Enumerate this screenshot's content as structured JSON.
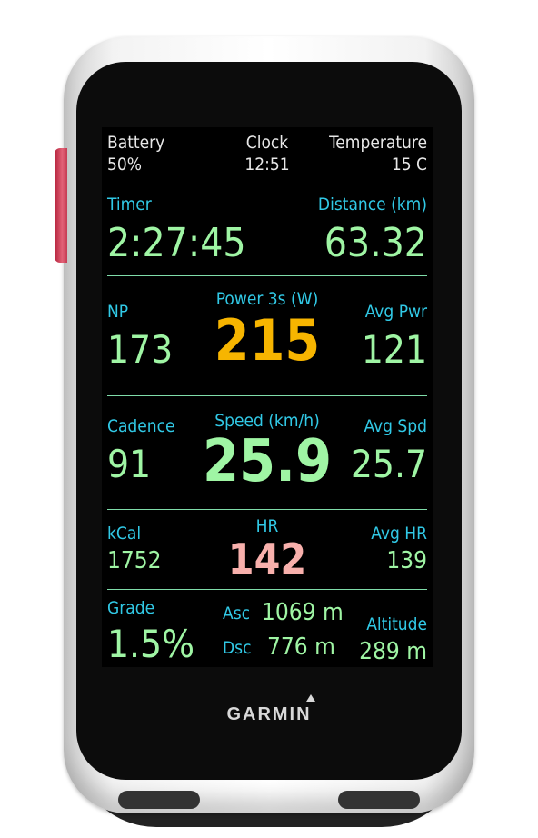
{
  "brand": "GARMIN",
  "colors": {
    "label": "#31c9e6",
    "value": "#9ff5a4",
    "power": "#f7b500",
    "hr": "#f8b0ac",
    "divider": "#7fdca9"
  },
  "top": {
    "battery_label": "Battery",
    "battery_value": "50%",
    "clock_label": "Clock",
    "clock_value": "12:51",
    "temp_label": "Temperature",
    "temp_value": "15 C"
  },
  "timer": {
    "label": "Timer",
    "value": "2:27:45"
  },
  "distance": {
    "label": "Distance (km)",
    "value": "63.32"
  },
  "np": {
    "label": "NP",
    "value": "173"
  },
  "power3s": {
    "label": "Power 3s (W)",
    "value": "215"
  },
  "avg_pwr": {
    "label": "Avg Pwr",
    "value": "121"
  },
  "cadence": {
    "label": "Cadence",
    "value": "91"
  },
  "speed": {
    "label": "Speed (km/h)",
    "value": "25.9"
  },
  "avg_spd": {
    "label": "Avg Spd",
    "value": "25.7"
  },
  "kcal": {
    "label": "kCal",
    "value": "1752"
  },
  "hr": {
    "label": "HR",
    "value": "142"
  },
  "avg_hr": {
    "label": "Avg HR",
    "value": "139"
  },
  "grade": {
    "label": "Grade",
    "value": "1.5%"
  },
  "asc": {
    "label": "Asc",
    "value": "1069 m"
  },
  "dsc": {
    "label": "Dsc",
    "value": "776 m"
  },
  "altitude": {
    "label": "Altitude",
    "value": "289 m"
  }
}
